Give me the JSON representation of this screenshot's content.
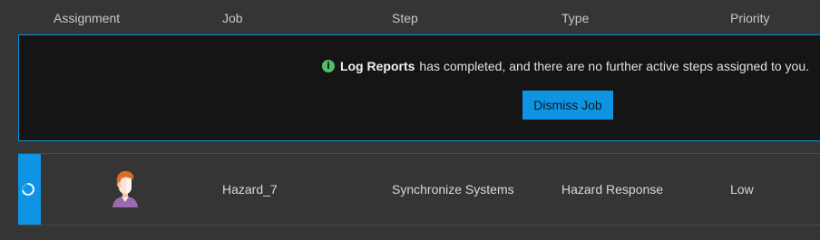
{
  "columns": {
    "assignment": "Assignment",
    "job": "Job",
    "step": "Step",
    "type": "Type",
    "priority": "Priority"
  },
  "notice": {
    "job_name": "Log Reports",
    "message": "has completed, and there are no further active steps assigned to you.",
    "dismiss_label": "Dismiss Job",
    "icon": "info-icon"
  },
  "rows": [
    {
      "avatar": "user-avatar",
      "job": "Hazard_7",
      "step": "Synchronize Systems",
      "type": "Hazard Response",
      "priority": "Low",
      "status_icon": "loading-spinner-icon"
    }
  ],
  "colors": {
    "accent": "#0e94e3",
    "info": "#4fbf6a",
    "panel": "#151515",
    "background": "#353535"
  }
}
